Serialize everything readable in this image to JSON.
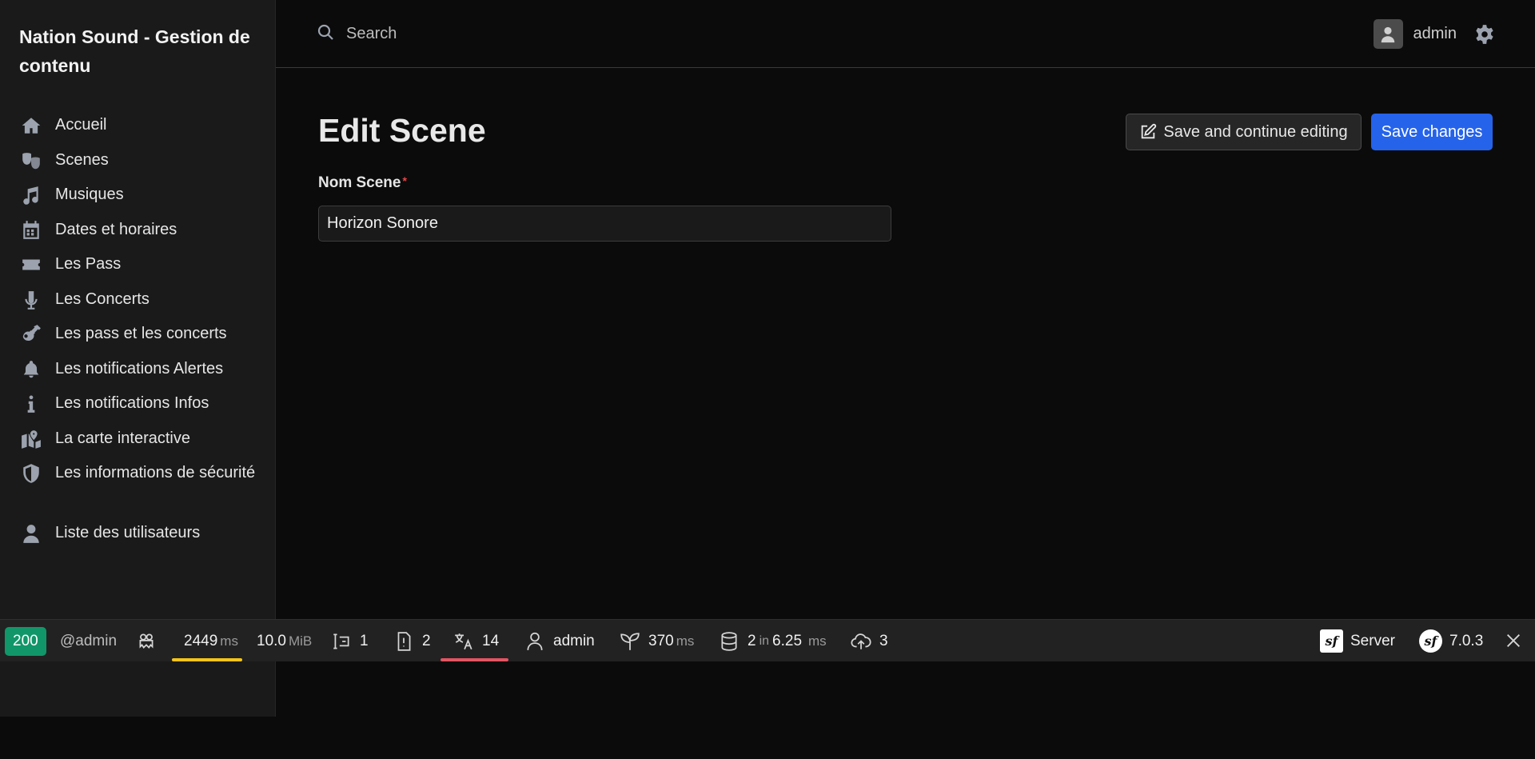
{
  "brand": "Nation Sound - Gestion de contenu",
  "sidebar": {
    "items": [
      {
        "label": "Accueil",
        "icon": "home-icon"
      },
      {
        "label": "Scenes",
        "icon": "theater-masks-icon"
      },
      {
        "label": "Musiques",
        "icon": "music-icon"
      },
      {
        "label": "Dates et horaires",
        "icon": "calendar-icon"
      },
      {
        "label": "Les Pass",
        "icon": "ticket-icon"
      },
      {
        "label": "Les Concerts",
        "icon": "microphone-icon"
      },
      {
        "label": "Les pass et les concerts",
        "icon": "guitar-icon"
      },
      {
        "label": "Les notifications Alertes",
        "icon": "bell-icon"
      },
      {
        "label": "Les notifications Infos",
        "icon": "info-icon"
      },
      {
        "label": "La carte interactive",
        "icon": "map-location-icon"
      },
      {
        "label": "Les informations de sécurité",
        "icon": "shield-icon"
      },
      {
        "label": "Liste des utilisateurs",
        "icon": "user-icon"
      }
    ]
  },
  "topbar": {
    "search_placeholder": "Search",
    "user_name": "admin"
  },
  "main": {
    "title": "Edit Scene",
    "save_continue_label": "Save and continue editing",
    "save_label": "Save changes",
    "field_label": "Nom Scene",
    "field_required_mark": "*",
    "field_value": "Horizon Sonore"
  },
  "toolbar": {
    "status_code": "200",
    "route": "@admin",
    "time_value": "2449",
    "time_unit": "ms",
    "memory_value": "10.0",
    "memory_unit": "MiB",
    "forms_count": "1",
    "logs_count": "2",
    "translations_count": "14",
    "security_user": "admin",
    "twig_time": "370",
    "twig_unit": "ms",
    "db_queries": "2",
    "db_in": "in",
    "db_time": "6.25",
    "db_unit": "ms",
    "http_count": "3",
    "server_label": "Server",
    "sf_version": "7.0.3",
    "accent_yellow": "#f5c518",
    "accent_red": "#e25563",
    "status_color": "#119669"
  }
}
